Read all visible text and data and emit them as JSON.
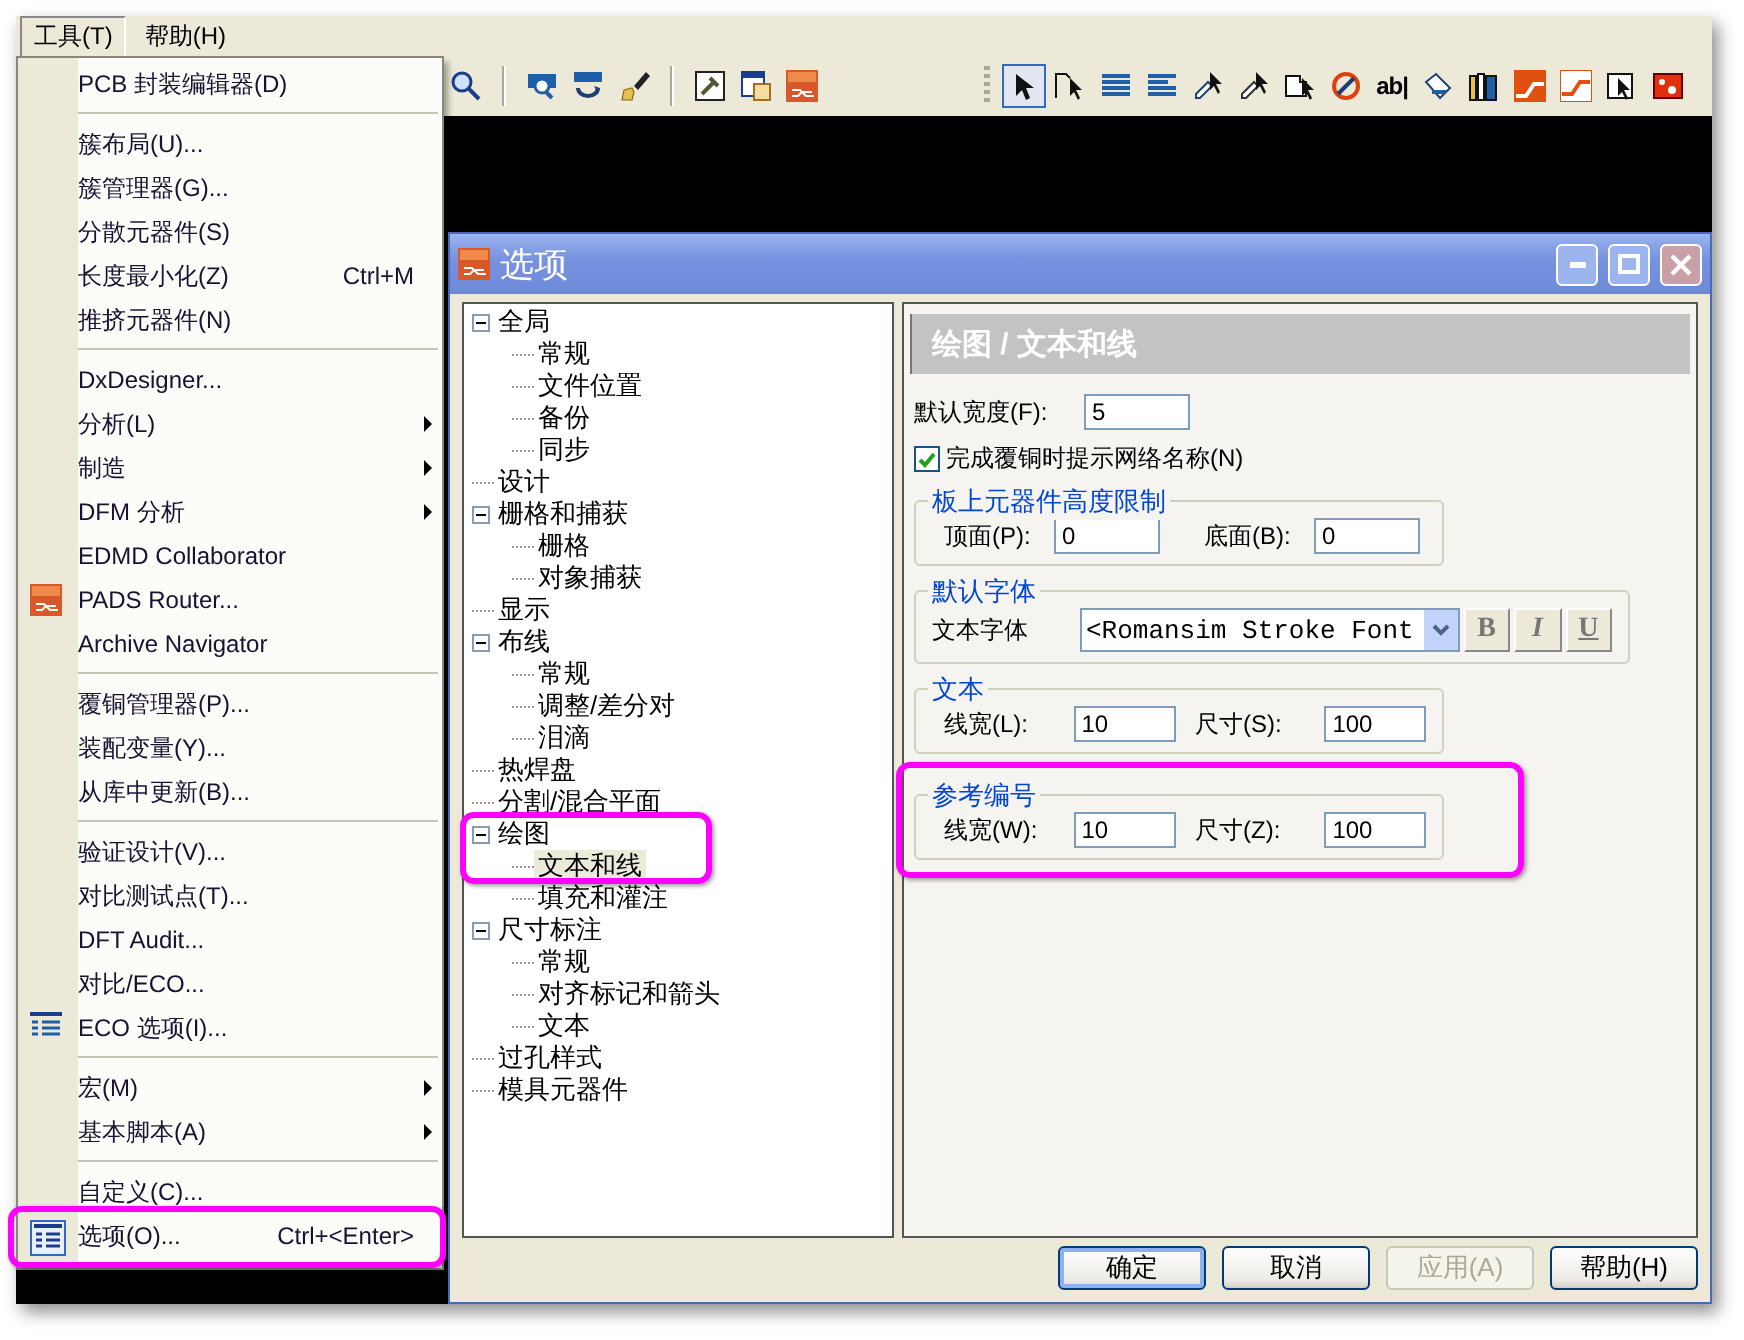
{
  "menubar": [
    {
      "label": "工具(T)",
      "selected": true
    },
    {
      "label": "帮助(H)",
      "selected": false
    }
  ],
  "toolbar": {
    "left": [
      {
        "selected": false
      },
      {
        "selected": false
      },
      {
        "selected": false
      },
      {
        "selected": false
      },
      {
        "selected": false
      },
      {
        "selected": false
      },
      {
        "selected": false
      }
    ],
    "right": [
      {
        "selected": true
      },
      {
        "selected": false
      },
      {
        "selected": false
      },
      {
        "selected": false
      },
      {
        "selected": false
      },
      {
        "selected": false
      },
      {
        "selected": false
      },
      {
        "selected": false
      },
      {
        "label": "ab|",
        "selected": false
      },
      {
        "selected": false
      },
      {
        "selected": false
      },
      {
        "selected": false
      },
      {
        "selected": false
      },
      {
        "selected": false
      },
      {
        "selected": false
      }
    ]
  },
  "tools_menu": [
    {
      "kind": "item",
      "label": "PCB 封装编辑器(D)",
      "submenu": false,
      "annotated": false
    },
    {
      "kind": "separator"
    },
    {
      "kind": "item",
      "label": "簇布局(U)...",
      "submenu": false,
      "annotated": false
    },
    {
      "kind": "item",
      "label": "簇管理器(G)...",
      "submenu": false,
      "annotated": false
    },
    {
      "kind": "item",
      "label": "分散元器件(S)",
      "submenu": false,
      "annotated": false
    },
    {
      "kind": "item",
      "label": "长度最小化(Z)",
      "shortcut": "Ctrl+M",
      "submenu": false,
      "annotated": false
    },
    {
      "kind": "item",
      "label": "推挤元器件(N)",
      "submenu": false,
      "annotated": false
    },
    {
      "kind": "separator"
    },
    {
      "kind": "item",
      "label": "DxDesigner...",
      "submenu": false,
      "annotated": false
    },
    {
      "kind": "item",
      "label": "分析(L)",
      "submenu": true,
      "annotated": false
    },
    {
      "kind": "item",
      "label": "制造",
      "submenu": true,
      "annotated": false
    },
    {
      "kind": "item",
      "label": "DFM 分析",
      "submenu": true,
      "annotated": false
    },
    {
      "kind": "item",
      "label": "EDMD Collaborator",
      "submenu": false,
      "annotated": false
    },
    {
      "kind": "item",
      "label": "PADS Router...",
      "submenu": false,
      "annotated": false
    },
    {
      "kind": "item",
      "label": "Archive Navigator",
      "submenu": false,
      "annotated": false
    },
    {
      "kind": "separator"
    },
    {
      "kind": "item",
      "label": "覆铜管理器(P)...",
      "submenu": false,
      "annotated": false
    },
    {
      "kind": "item",
      "label": "装配变量(Y)...",
      "submenu": false,
      "annotated": false
    },
    {
      "kind": "item",
      "label": "从库中更新(B)...",
      "submenu": false,
      "annotated": false
    },
    {
      "kind": "separator"
    },
    {
      "kind": "item",
      "label": "验证设计(V)...",
      "submenu": false,
      "annotated": false
    },
    {
      "kind": "item",
      "label": "对比测试点(T)...",
      "submenu": false,
      "annotated": false
    },
    {
      "kind": "item",
      "label": "DFT Audit...",
      "submenu": false,
      "annotated": false
    },
    {
      "kind": "item",
      "label": "对比/ECO...",
      "submenu": false,
      "annotated": false
    },
    {
      "kind": "item",
      "label": "ECO 选项(I)...",
      "submenu": false,
      "annotated": false
    },
    {
      "kind": "separator"
    },
    {
      "kind": "item",
      "label": "宏(M)",
      "submenu": true,
      "annotated": false
    },
    {
      "kind": "item",
      "label": "基本脚本(A)",
      "submenu": true,
      "annotated": false
    },
    {
      "kind": "separator"
    },
    {
      "kind": "item",
      "label": "自定义(C)...",
      "submenu": false,
      "annotated": false
    },
    {
      "kind": "item",
      "label": "选项(O)...",
      "shortcut": "Ctrl+<Enter>",
      "submenu": false,
      "annotated": true
    }
  ],
  "options_dialog": {
    "title": "选项",
    "tree": [
      {
        "label": "全局",
        "selected": false,
        "expanded": true,
        "annotated": false,
        "children": [
          {
            "label": "常规",
            "selected": false
          },
          {
            "label": "文件位置",
            "selected": false
          },
          {
            "label": "备份",
            "selected": false
          },
          {
            "label": "同步",
            "selected": false
          }
        ]
      },
      {
        "label": "设计",
        "selected": false,
        "annotated": false
      },
      {
        "label": "栅格和捕获",
        "selected": false,
        "expanded": true,
        "annotated": false,
        "children": [
          {
            "label": "栅格",
            "selected": false
          },
          {
            "label": "对象捕获",
            "selected": false
          }
        ]
      },
      {
        "label": "显示",
        "selected": false,
        "annotated": false
      },
      {
        "label": "布线",
        "selected": false,
        "expanded": true,
        "annotated": false,
        "children": [
          {
            "label": "常规",
            "selected": false
          },
          {
            "label": "调整/差分对",
            "selected": false
          },
          {
            "label": "泪滴",
            "selected": false
          }
        ]
      },
      {
        "label": "热焊盘",
        "selected": false,
        "annotated": false
      },
      {
        "label": "分割/混合平面",
        "selected": false,
        "annotated": false
      },
      {
        "label": "绘图",
        "selected": false,
        "expanded": true,
        "annotated": true,
        "children": [
          {
            "label": "文本和线",
            "selected": true
          },
          {
            "label": "填充和灌注",
            "selected": false
          }
        ]
      },
      {
        "label": "尺寸标注",
        "selected": false,
        "expanded": true,
        "annotated": false,
        "children": [
          {
            "label": "常规",
            "selected": false
          },
          {
            "label": "对齐标记和箭头",
            "selected": false
          },
          {
            "label": "文本",
            "selected": false
          }
        ]
      },
      {
        "label": "过孔样式",
        "selected": false,
        "annotated": false
      },
      {
        "label": "模具元器件",
        "selected": false,
        "annotated": false
      }
    ],
    "page": {
      "header": "绘图 / 文本和线",
      "default_width": {
        "label": "默认宽度(F):",
        "value": "5"
      },
      "net_name_checkbox": {
        "label": "完成覆铜时提示网络名称(N)",
        "checked": true
      },
      "groups": [
        {
          "kind": "pair",
          "title": "板上元器件高度限制",
          "annotated": false,
          "fields": [
            {
              "label": "顶面(P):",
              "value": "0"
            },
            {
              "label": "底面(B):",
              "value": "0"
            }
          ]
        },
        {
          "kind": "font",
          "title": "默认字体",
          "annotated": false,
          "label": "文本字体",
          "value": "<Romansim Stroke Font",
          "styles": [
            "B",
            "I",
            "U"
          ]
        },
        {
          "kind": "pair",
          "title": "文本",
          "annotated": false,
          "fields": [
            {
              "label": "线宽(L):",
              "value": "10"
            },
            {
              "label": "尺寸(S):",
              "value": "100"
            }
          ]
        },
        {
          "kind": "pair",
          "title": "参考编号",
          "annotated": true,
          "fields": [
            {
              "label": "线宽(W):",
              "value": "10"
            },
            {
              "label": "尺寸(Z):",
              "value": "100"
            }
          ]
        }
      ]
    },
    "buttons": [
      {
        "label": "确定",
        "default": true,
        "disabled": false
      },
      {
        "label": "取消",
        "default": false,
        "disabled": false
      },
      {
        "label": "应用(A)",
        "default": false,
        "disabled": true
      },
      {
        "label": "帮助(H)",
        "default": false,
        "disabled": false
      }
    ]
  }
}
